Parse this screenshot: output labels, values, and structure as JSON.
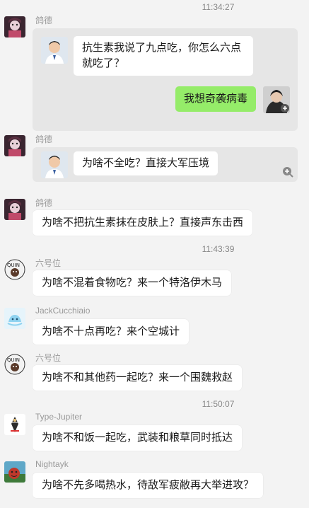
{
  "timestamps": [
    "11:34:27",
    "11:43:39",
    "11:50:07"
  ],
  "messages": [
    {
      "sender": "鸽德",
      "quote": {
        "left_text": "抗生素我说了九点吃，你怎么六点就吃了？",
        "right_text": "我想奇袭病毒"
      }
    },
    {
      "sender": "鸽德",
      "quote": {
        "left_text": "为啥不全吃？直接大军压境"
      }
    },
    {
      "sender": "鸽德",
      "text": "为啥不把抗生素抹在皮肤上？直接声东击西"
    },
    {
      "sender": "六号位",
      "text": "为啥不混着食物吃？来一个特洛伊木马"
    },
    {
      "sender": "JackCucchiaio",
      "text": "为啥不十点再吃？来个空城计"
    },
    {
      "sender": "六号位",
      "text": "为啥不和其他药一起吃？来一个围魏救赵"
    },
    {
      "sender": "Type-Jupiter",
      "text": "为啥不和饭一起吃，武装和粮草同时抵达"
    },
    {
      "sender": "Nightayk",
      "text": "为啥不先多喝热水，待敌军疲敝再大举进攻？"
    }
  ],
  "colors": {
    "background": "#f3f3f3",
    "bubble": "#ffffff",
    "self_bubble": "#95ec69",
    "quote_card": "#e6e6e6"
  },
  "icons": [
    "avatar-gede",
    "avatar-doctor",
    "avatar-liuhaowei",
    "avatar-jack",
    "avatar-jupiter",
    "avatar-nightayk",
    "zoom-in-icon"
  ]
}
